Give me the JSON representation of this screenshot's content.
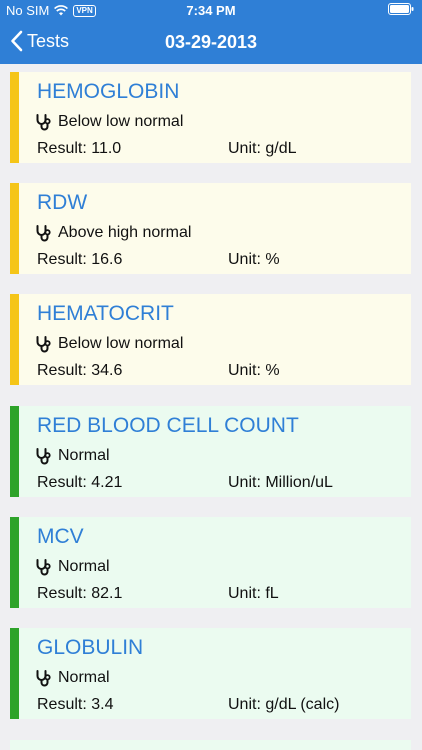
{
  "status_bar": {
    "carrier": "No SIM",
    "vpn": "VPN",
    "time": "7:34 PM"
  },
  "nav": {
    "back_label": "Tests",
    "title": "03-29-2013"
  },
  "colors": {
    "header_bg": "#2f7fd6",
    "abnormal_bar": "#f5c518",
    "normal_bar": "#2ea32a"
  },
  "tests": [
    {
      "name": "HEMOGLOBIN",
      "status": "Below low normal",
      "result": "Result: 11.0",
      "unit": "Unit: g/dL",
      "flag": "abnormal"
    },
    {
      "name": "RDW",
      "status": "Above high normal",
      "result": "Result: 16.6",
      "unit": "Unit: %",
      "flag": "abnormal"
    },
    {
      "name": "HEMATOCRIT",
      "status": "Below low normal",
      "result": "Result: 34.6",
      "unit": "Unit: %",
      "flag": "abnormal"
    },
    {
      "name": "RED BLOOD CELL COUNT",
      "status": "Normal",
      "result": "Result: 4.21",
      "unit": "Unit: Million/uL",
      "flag": "normal"
    },
    {
      "name": "MCV",
      "status": "Normal",
      "result": "Result: 82.1",
      "unit": "Unit: fL",
      "flag": "normal"
    },
    {
      "name": "GLOBULIN",
      "status": "Normal",
      "result": "Result: 3.4",
      "unit": "Unit: g/dL (calc)",
      "flag": "normal"
    }
  ]
}
